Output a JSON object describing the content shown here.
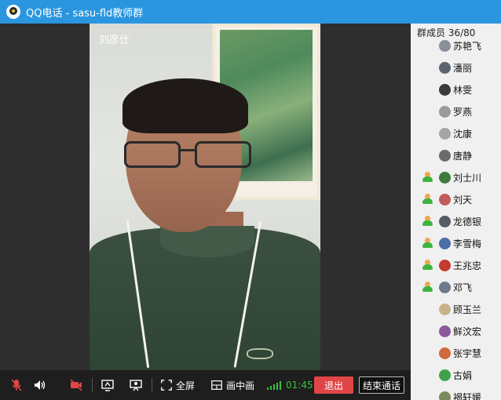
{
  "window": {
    "title": "QQ电话 - sasu-fld教师群"
  },
  "video": {
    "caller_name": "刘彦仕"
  },
  "members_panel": {
    "header": "群成员 36/80",
    "members": [
      {
        "name": "苏艳飞",
        "speaking": false,
        "avatar_color": "#8a8f99"
      },
      {
        "name": "潘丽",
        "speaking": false,
        "avatar_color": "#5b6570"
      },
      {
        "name": "林雯",
        "speaking": false,
        "avatar_color": "#3a3a3a"
      },
      {
        "name": "罗燕",
        "speaking": false,
        "avatar_color": "#9a9a9a"
      },
      {
        "name": "沈康",
        "speaking": false,
        "avatar_color": "#a5a5a5"
      },
      {
        "name": "唐静",
        "speaking": false,
        "avatar_color": "#6a6a6a"
      },
      {
        "name": "刘士川",
        "speaking": true,
        "avatar_color": "#3d7a3f"
      },
      {
        "name": "刘天",
        "speaking": true,
        "avatar_color": "#c45a5a"
      },
      {
        "name": "龙德银",
        "speaking": true,
        "avatar_color": "#555d66"
      },
      {
        "name": "李雪梅",
        "speaking": true,
        "avatar_color": "#4a6fa5"
      },
      {
        "name": "王兆忠",
        "speaking": true,
        "avatar_color": "#c43b2f"
      },
      {
        "name": "邓飞",
        "speaking": true,
        "avatar_color": "#6c7a8a"
      },
      {
        "name": "顾玉兰",
        "speaking": false,
        "avatar_color": "#c9b18a"
      },
      {
        "name": "鲜汶宏",
        "speaking": false,
        "avatar_color": "#8c5a9a"
      },
      {
        "name": "张宇慧",
        "speaking": false,
        "avatar_color": "#d06a3a"
      },
      {
        "name": "古娟",
        "speaking": false,
        "avatar_color": "#3fa24a"
      },
      {
        "name": "褐轩媛",
        "speaking": false,
        "avatar_color": "#7a8a5a"
      }
    ]
  },
  "toolbar": {
    "fullscreen_label": "全屏",
    "pip_label": "画中画",
    "call_duration": "01:45",
    "exit_label": "退出",
    "end_call_label": "结束通话"
  },
  "colors": {
    "accent": "#2a96e0",
    "exit_button": "#e04545",
    "signal": "#37c23b",
    "mute_red": "#e04545"
  }
}
